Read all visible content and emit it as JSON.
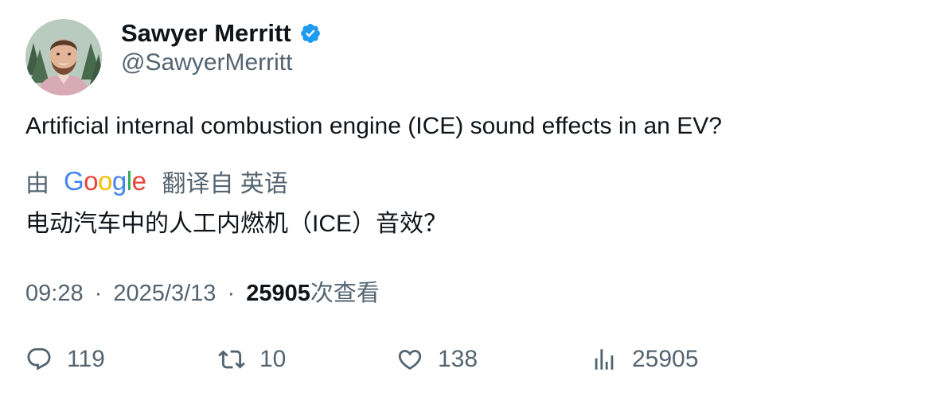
{
  "author": {
    "name": "Sawyer Merritt",
    "handle": "@SawyerMerritt",
    "verified": true
  },
  "tweet": {
    "text": "Artificial internal combustion engine (ICE) sound effects in an EV?"
  },
  "translation": {
    "by_label": "由",
    "provider_logo": [
      "G",
      "o",
      "o",
      "g",
      "l",
      "e"
    ],
    "translated_from": "翻译自 英语",
    "text": "电动汽车中的人工内燃机（ICE）音效？"
  },
  "meta": {
    "time": "09:28",
    "separator": "·",
    "date": "2025/3/13",
    "views_count": "25905",
    "views_label": "次查看"
  },
  "actions": {
    "replies": "119",
    "retweets": "10",
    "likes": "138",
    "views": "25905"
  },
  "colors": {
    "text_primary": "#0f1419",
    "text_secondary": "#536471",
    "verified_blue": "#1d9bf0"
  },
  "icons": {
    "reply": "speech-bubble-icon",
    "retweet": "retweet-arrows-icon",
    "like": "heart-icon",
    "views": "bar-chart-icon",
    "verified": "verified-badge-icon"
  }
}
